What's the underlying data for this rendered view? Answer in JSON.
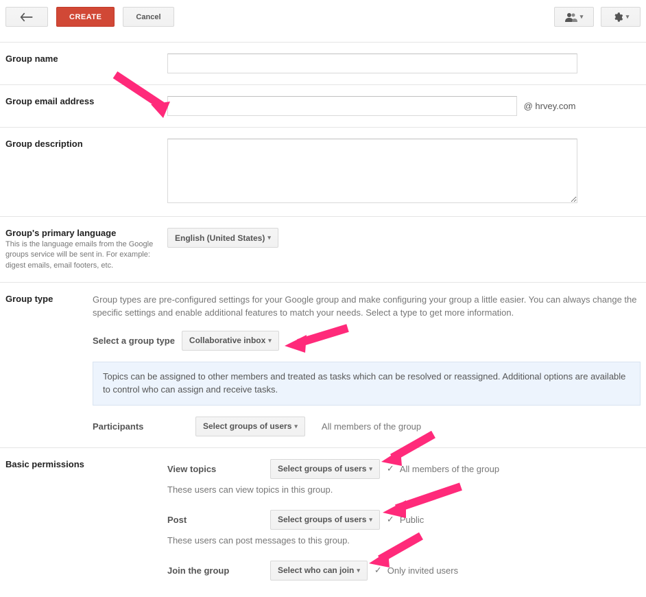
{
  "toolbar": {
    "create_label": "CREATE",
    "cancel_label": "Cancel"
  },
  "fields": {
    "name_label": "Group name",
    "email_label": "Group email address",
    "email_suffix": "@ hrvey.com",
    "description_label": "Group description",
    "language_label": "Group's primary language",
    "language_help": "This is the language emails from the Google groups service will be sent in. For example: digest emails, email footers, etc.",
    "language_value": "English (United States)",
    "grouptype_label": "Group type",
    "grouptype_desc": "Group types are pre-configured settings for your Google group and make configuring your group a little easier. You can always change the specific settings and enable additional features to match your needs. Select a type to get more information.",
    "grouptype_select_label": "Select a group type",
    "grouptype_value": "Collaborative inbox",
    "grouptype_info": "Topics can be assigned to other members and treated as tasks which can be resolved or reassigned. Additional options are available to control who can assign and receive tasks.",
    "participants_label": "Participants",
    "participants_selector": "Select groups of users",
    "participants_value": "All members of the group",
    "permissions_label": "Basic permissions",
    "view_label": "View topics",
    "view_selector": "Select groups of users",
    "view_value": "All members of the group",
    "view_help": "These users can view topics in this group.",
    "post_label": "Post",
    "post_selector": "Select groups of users",
    "post_value": "Public",
    "post_help": "These users can post messages to this group.",
    "join_label": "Join the group",
    "join_selector": "Select who can join",
    "join_value": "Only invited users"
  }
}
